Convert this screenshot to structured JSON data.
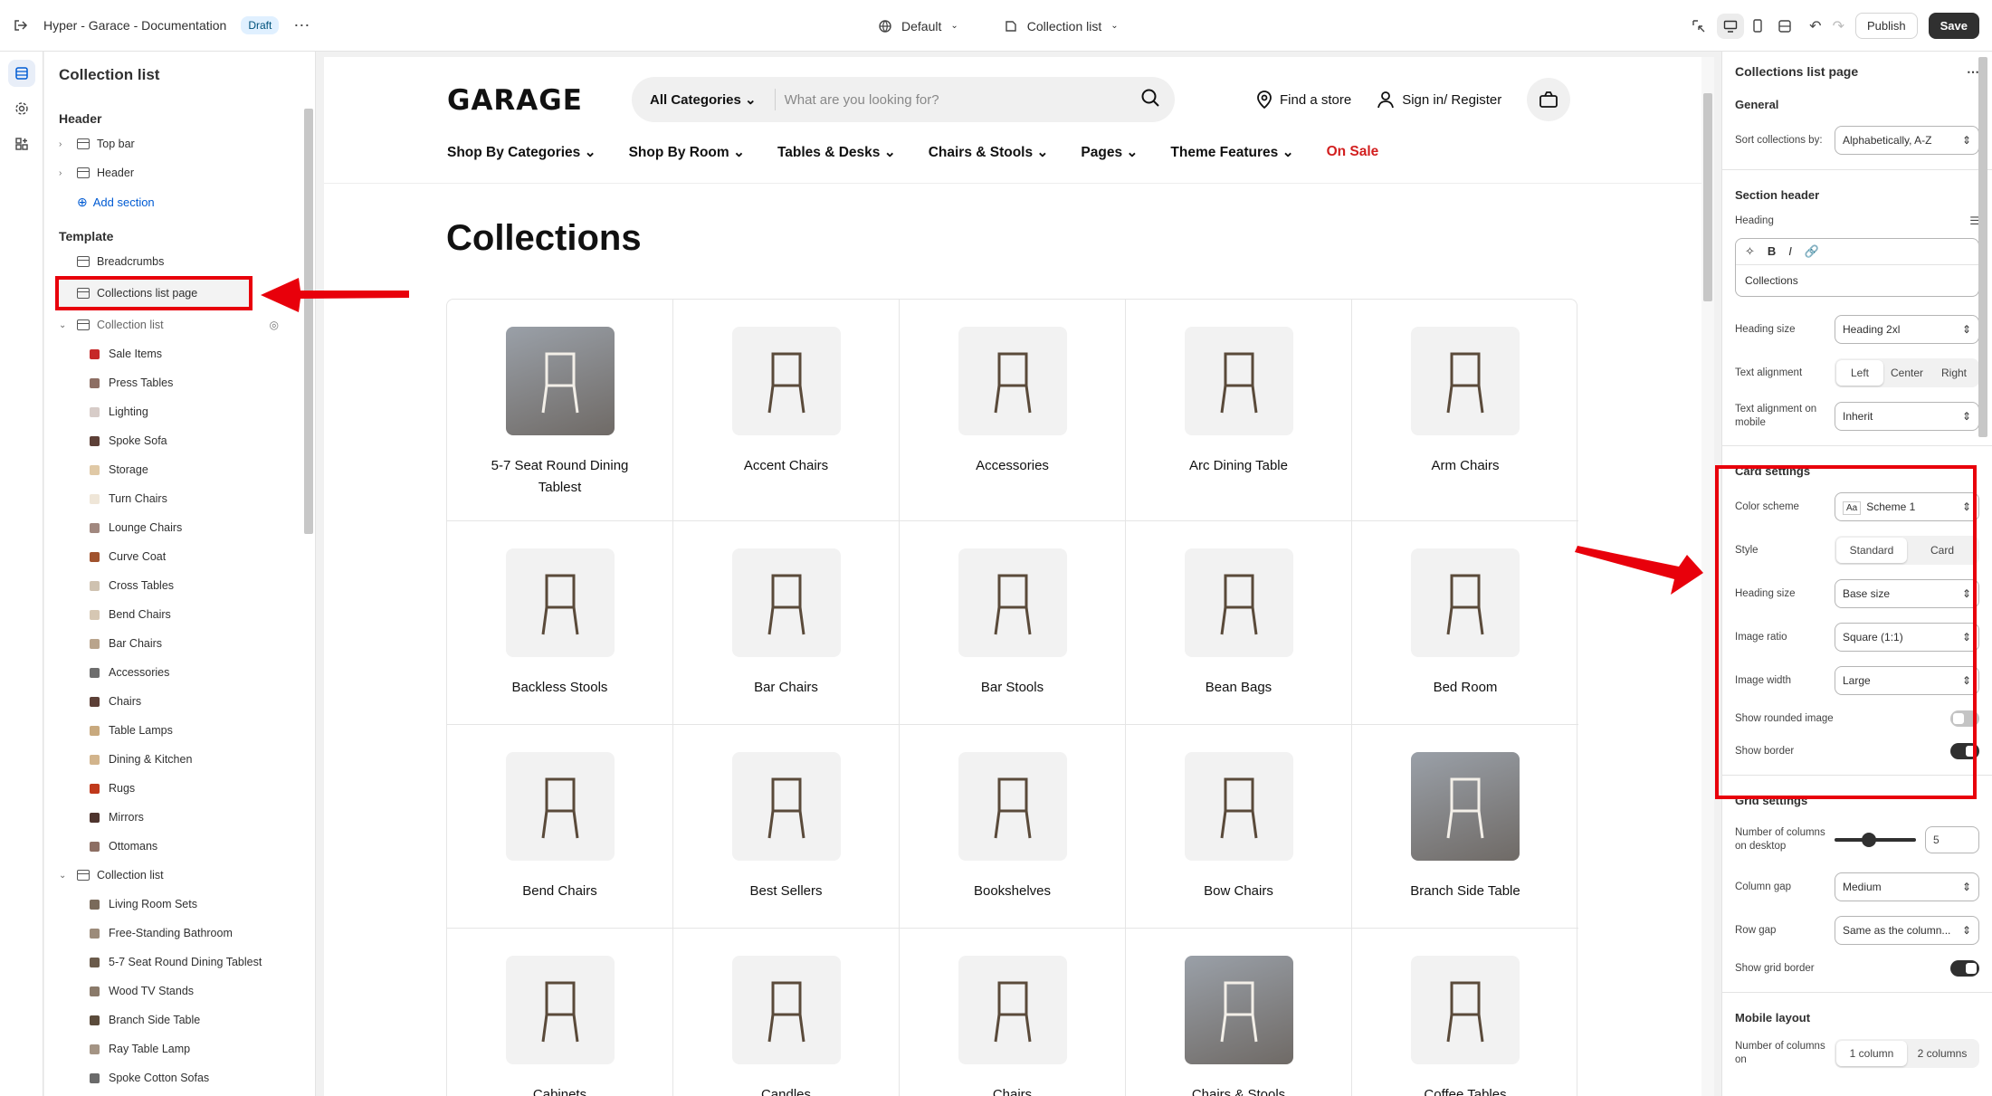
{
  "topbar": {
    "title": "Hyper - Garace - Documentation",
    "badge": "Draft",
    "theme_select": "Default",
    "template_select": "Collection list",
    "publish_label": "Publish",
    "save_label": "Save"
  },
  "sidebar": {
    "title": "Collection list",
    "header_group": "Header",
    "header_items": [
      "Top bar",
      "Header"
    ],
    "add_section": "Add section",
    "template_group": "Template",
    "template_items": [
      "Breadcrumbs",
      "Collections list page",
      "Collection list"
    ],
    "collection_items_1": [
      "Sale Items",
      "Press Tables",
      "Lighting",
      "Spoke Sofa",
      "Storage",
      "Turn Chairs",
      "Lounge Chairs",
      "Curve Coat",
      "Cross Tables",
      "Bend Chairs",
      "Bar Chairs",
      "Accessories",
      "Chairs",
      "Table Lamps",
      "Dining & Kitchen",
      "Rugs",
      "Mirrors",
      "Ottomans"
    ],
    "collection_list_2": "Collection list",
    "collection_items_2": [
      "Living Room Sets",
      "Free-Standing Bathroom",
      "5-7 Seat Round Dining Tablest",
      "Wood TV Stands",
      "Branch Side Table",
      "Ray Table Lamp",
      "Spoke Cotton Sofas"
    ]
  },
  "store": {
    "logo": "GARAGE",
    "search_category": "All Categories",
    "search_placeholder": "What are you looking for?",
    "find_store": "Find a store",
    "sign_in": "Sign in/ Register",
    "nav": [
      "Shop By Categories",
      "Shop By Room",
      "Tables & Desks",
      "Chairs & Stools",
      "Pages",
      "Theme Features"
    ],
    "nav_sale": "On Sale",
    "page_heading": "Collections",
    "collections": [
      "5-7 Seat Round Dining Tablest",
      "Accent Chairs",
      "Accessories",
      "Arc Dining Table",
      "Arm Chairs",
      "Backless Stools",
      "Bar Chairs",
      "Bar Stools",
      "Bean Bags",
      "Bed Room",
      "Bend Chairs",
      "Best Sellers",
      "Bookshelves",
      "Bow Chairs",
      "Branch Side Table",
      "Cabinets",
      "Candles",
      "Chairs",
      "Chairs & Stools",
      "Coffee Tables"
    ]
  },
  "panel": {
    "title": "Collections list page",
    "general": "General",
    "sort_label": "Sort collections by:",
    "sort_value": "Alphabetically, A-Z",
    "section_header": "Section header",
    "heading_label": "Heading",
    "heading_value": "Collections",
    "heading_size_label": "Heading size",
    "heading_size_value": "Heading 2xl",
    "text_align_label": "Text alignment",
    "text_align_options": [
      "Left",
      "Center",
      "Right"
    ],
    "text_align_mobile_label": "Text alignment on mobile",
    "text_align_mobile_value": "Inherit",
    "card_settings": "Card settings",
    "color_scheme_label": "Color scheme",
    "color_scheme_value": "Scheme 1",
    "style_label": "Style",
    "style_options": [
      "Standard",
      "Card"
    ],
    "card_heading_size_label": "Heading size",
    "card_heading_size_value": "Base size",
    "image_ratio_label": "Image ratio",
    "image_ratio_value": "Square (1:1)",
    "image_width_label": "Image width",
    "image_width_value": "Large",
    "rounded_label": "Show rounded image",
    "border_label": "Show border",
    "grid_settings": "Grid settings",
    "columns_label": "Number of columns on desktop",
    "columns_value": "5",
    "column_gap_label": "Column gap",
    "column_gap_value": "Medium",
    "row_gap_label": "Row gap",
    "row_gap_value": "Same as the column...",
    "grid_border_label": "Show grid border",
    "mobile_layout": "Mobile layout",
    "mobile_columns_label": "Number of columns on",
    "mobile_options": [
      "1 column",
      "2 columns"
    ]
  }
}
